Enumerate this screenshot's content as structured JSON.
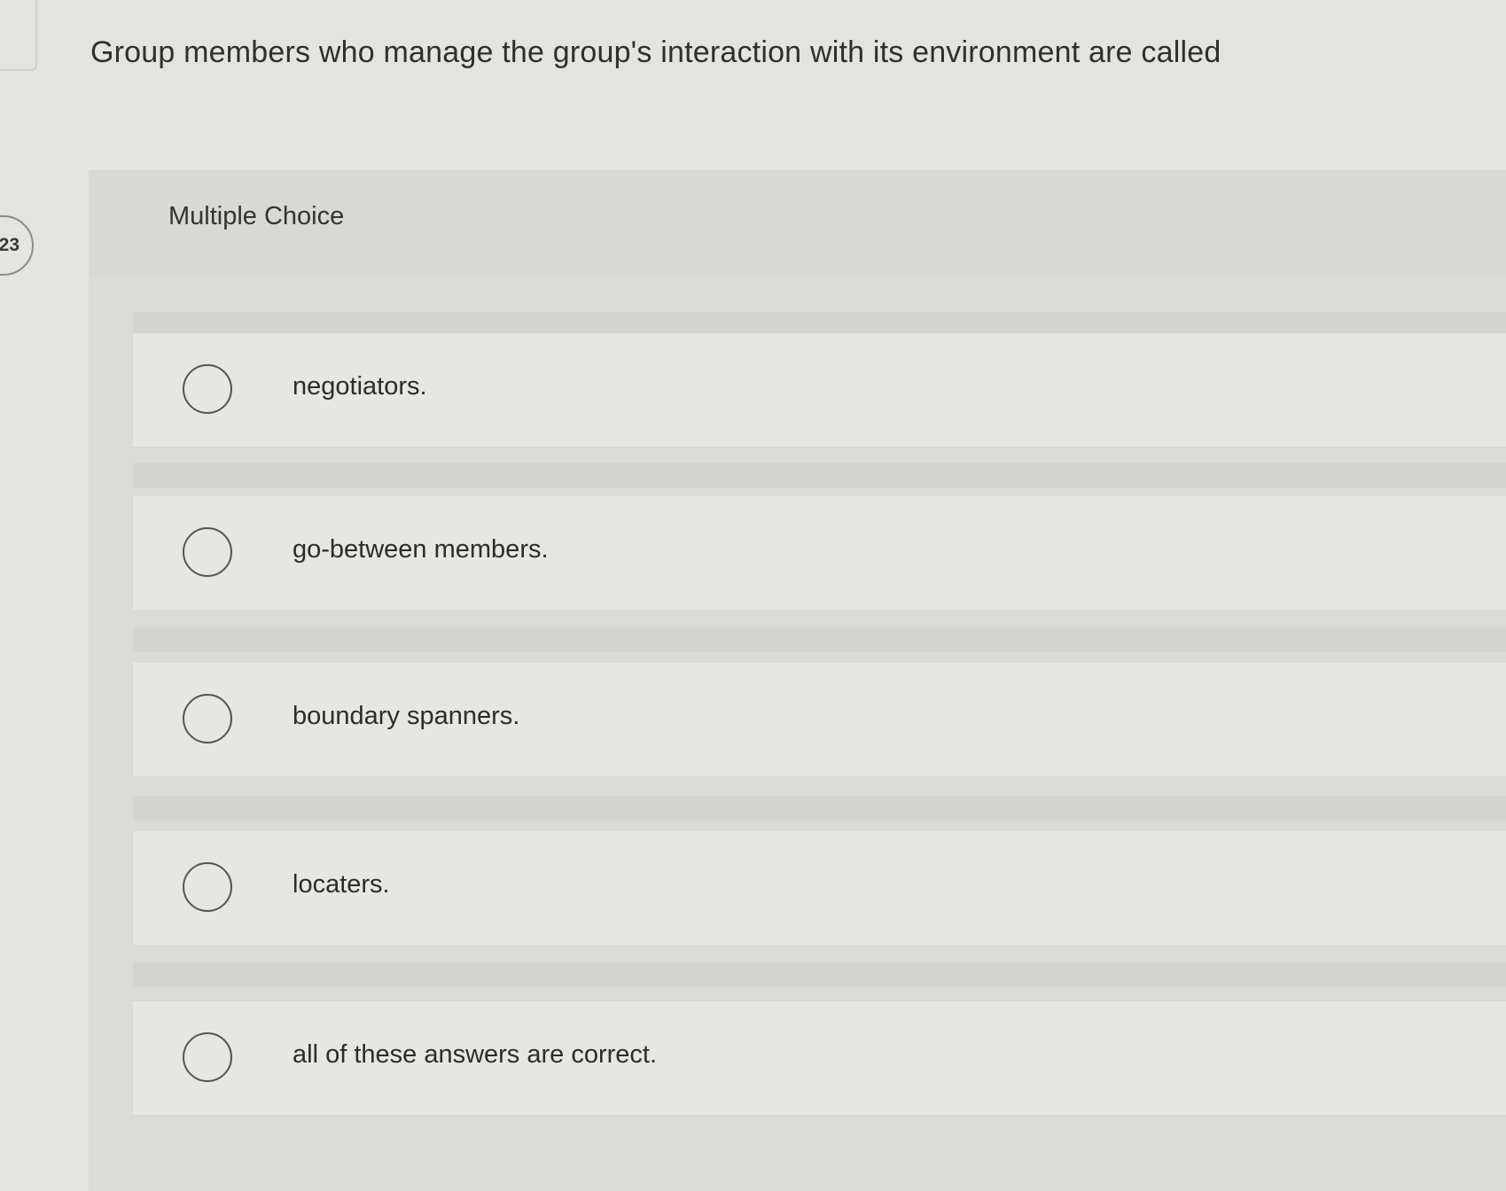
{
  "question": {
    "number": "23",
    "text": "Group members who manage the group's interaction with its environment are called",
    "type_label": "Multiple Choice"
  },
  "options": [
    {
      "label": "negotiators."
    },
    {
      "label": "go-between members."
    },
    {
      "label": "boundary spanners."
    },
    {
      "label": "locaters."
    },
    {
      "label": "all of these answers are correct."
    }
  ]
}
